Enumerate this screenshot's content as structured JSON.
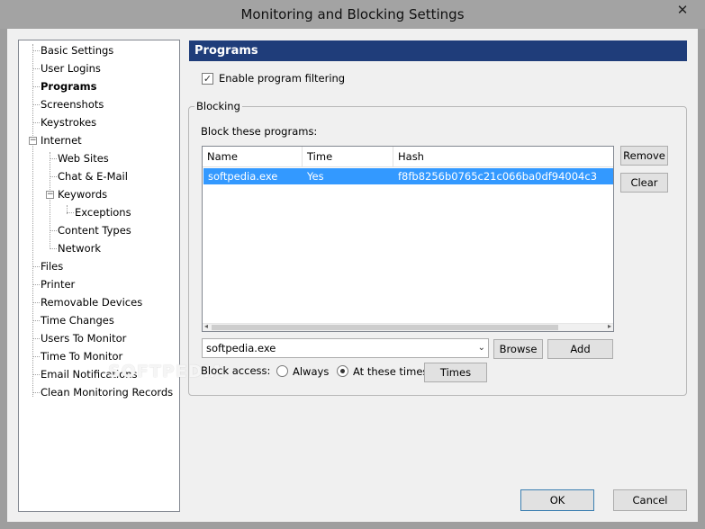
{
  "window": {
    "title": "Monitoring and Blocking Settings",
    "close_glyph": "✕"
  },
  "tree": {
    "items": [
      {
        "label": "Basic Settings"
      },
      {
        "label": "User Logins"
      },
      {
        "label": "Programs",
        "selected": true
      },
      {
        "label": "Screenshots"
      },
      {
        "label": "Keystrokes"
      },
      {
        "label": "Internet",
        "expanded": true
      },
      {
        "label": "Web Sites"
      },
      {
        "label": "Chat & E-Mail"
      },
      {
        "label": "Keywords",
        "expanded": true
      },
      {
        "label": "Exceptions"
      },
      {
        "label": "Content Types"
      },
      {
        "label": "Network"
      },
      {
        "label": "Files"
      },
      {
        "label": "Printer"
      },
      {
        "label": "Removable Devices"
      },
      {
        "label": "Time Changes"
      },
      {
        "label": "Users To Monitor"
      },
      {
        "label": "Time To Monitor"
      },
      {
        "label": "Email Notifications"
      },
      {
        "label": "Clean Monitoring Records"
      }
    ]
  },
  "section": {
    "title": "Programs",
    "enable_filtering_label": "Enable program filtering",
    "enable_filtering_checked": true
  },
  "blocking": {
    "group_label": "Blocking",
    "list_label": "Block these programs:",
    "columns": [
      "Name",
      "Time",
      "Hash"
    ],
    "rows": [
      {
        "name": "softpedia.exe",
        "time": "Yes",
        "hash": "f8fb8256b0765c21c066ba0df94004c3"
      }
    ],
    "remove_label": "Remove",
    "clear_label": "Clear",
    "program_input_value": "softpedia.exe",
    "browse_label": "Browse",
    "add_label": "Add",
    "block_access_label": "Block access:",
    "always_label": "Always",
    "at_times_label": "At these times:",
    "selected_option": "at_times",
    "times_label": "Times"
  },
  "footer": {
    "ok_label": "OK",
    "cancel_label": "Cancel"
  },
  "watermark": "SOFTPEDIA",
  "colors": {
    "header_band": "#1f3d7a",
    "selection": "#3399ff"
  }
}
